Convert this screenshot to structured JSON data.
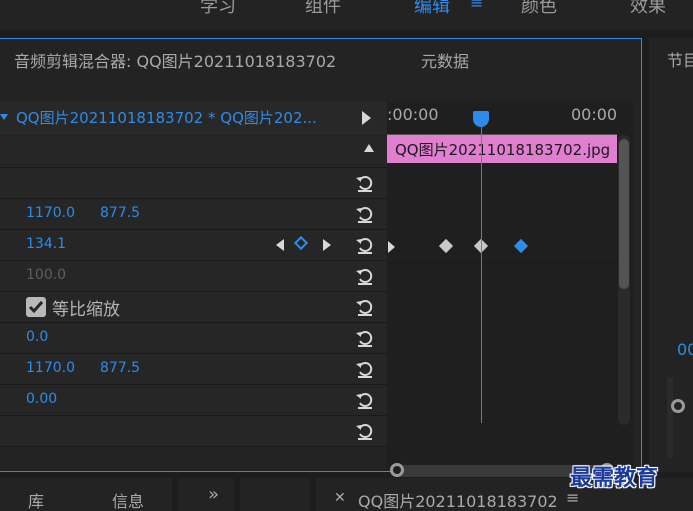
{
  "workspace": {
    "tabs": [
      {
        "label": "学习",
        "active": false
      },
      {
        "label": "组件",
        "active": false
      },
      {
        "label": "编辑",
        "active": true
      },
      {
        "label": "颜色",
        "active": false
      },
      {
        "label": "效果",
        "active": false
      }
    ],
    "menu_glyph": "≡"
  },
  "panel": {
    "tabs": [
      "音频剪辑混合器: QQ图片20211018183702",
      "元数据"
    ],
    "clip_header": "QQ图片20211018183702 * QQ图片202...",
    "rows": [
      {
        "v1": "",
        "v2": ""
      },
      {
        "v1": "",
        "v2": ""
      },
      {
        "v1": "1170.0",
        "v2": "877.5"
      },
      {
        "v1": "134.1",
        "v2": ""
      },
      {
        "v1": "100.0",
        "v2": ""
      },
      {
        "v1": "",
        "v2": ""
      },
      {
        "v1": "0.0",
        "v2": ""
      },
      {
        "v1": "1170.0",
        "v2": "877.5"
      },
      {
        "v1": "0.00",
        "v2": ""
      },
      {
        "v1": "",
        "v2": ""
      }
    ],
    "uniform_scale_label": "等比缩放",
    "uniform_scale_checked": true
  },
  "timeline": {
    "timecode_start": ":00:00",
    "timecode_end": "00:00",
    "clip_name": "QQ图片20211018183702.jpg"
  },
  "right_panel": {
    "title": "节目",
    "value": "00"
  },
  "bottom_tabs": {
    "tab1": "库",
    "tab2": "信息",
    "overflow": "»",
    "sequence_tab": "QQ图片20211018183702",
    "menu_glyph": "≡"
  },
  "watermark": "最需教育",
  "colors": {
    "accent": "#2d8ceb",
    "clip_pink": "#e07fd0"
  }
}
